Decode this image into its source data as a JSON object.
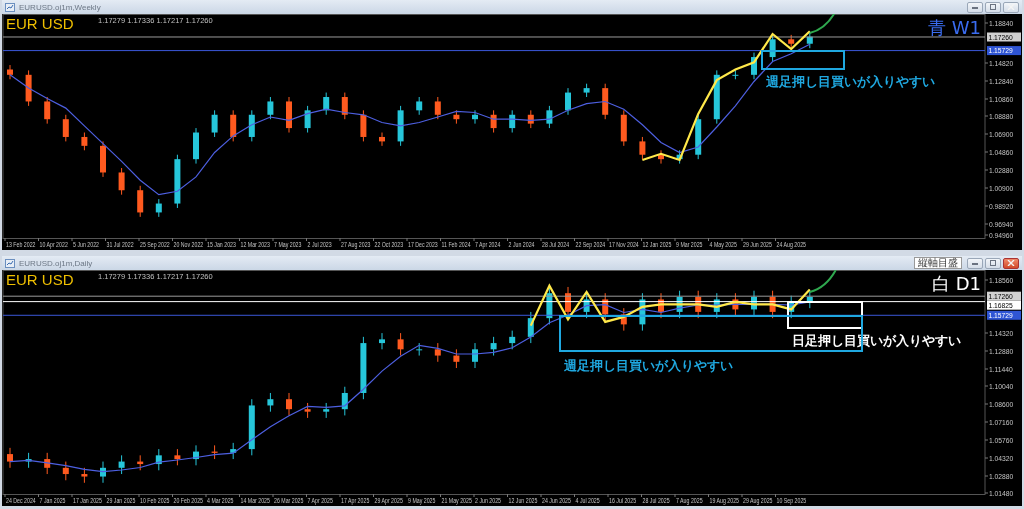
{
  "windows": [
    {
      "title": "EURUSD.oj1m,Weekly",
      "symbol_label": "EUR USD",
      "ohlc": "1.17279 1.17336 1.17217 1.17260",
      "timeframe_label": {
        "text": "青 W1",
        "color": "#3a6cf0"
      },
      "price_tags": [
        {
          "text": "1.17260",
          "kind": "last"
        },
        {
          "text": "1.15729",
          "kind": "line"
        }
      ],
      "notes": [
        {
          "text": "週足押し目買いが入りやすい",
          "color": "#1fa8e0"
        }
      ],
      "x_axis_labels": [
        "13 Feb 2022",
        "10 Apr 2022",
        "5 Jun 2022",
        "31 Jul 2022",
        "25 Sep 2022",
        "20 Nov 2022",
        "15 Jan 2023",
        "12 Mar 2023",
        "7 May 2023",
        "2 Jul 2023",
        "27 Aug 2023",
        "22 Oct 2023",
        "17 Dec 2023",
        "11 Feb 2024",
        "7 Apr 2024",
        "2 Jun 2024",
        "28 Jul 2024",
        "22 Sep 2024",
        "17 Nov 2024",
        "12 Jan 2025",
        "9 Mar 2025",
        "4 May 2025",
        "29 Jun 2025",
        "24 Aug 2025"
      ],
      "y_axis_labels": [
        "1.18840",
        "1.14820",
        "1.12840",
        "1.10860",
        "1.08880",
        "1.06900",
        "1.04860",
        "1.02880",
        "1.00900",
        "0.98920",
        "0.96940",
        "0.94960"
      ]
    },
    {
      "title": "EURUSD.oj1m,Daily",
      "symbol_label": "EUR USD",
      "ohlc": "1.17279 1.17336 1.17217 1.17260",
      "timeframe_label": {
        "text": "白 D1",
        "color": "#ffffff"
      },
      "tooltip": "縦軸目盛",
      "price_tags": [
        {
          "text": "1.17260",
          "kind": "last"
        },
        {
          "text": "1.16825",
          "kind": "level"
        },
        {
          "text": "1.15729",
          "kind": "line"
        }
      ],
      "notes": [
        {
          "text": "日足押し目買いが入りやすい",
          "color": "#ffffff"
        },
        {
          "text": "週足押し目買いが入りやすい",
          "color": "#1fa8e0"
        }
      ],
      "x_axis_labels": [
        "24 Dec 2024",
        "7 Jan 2025",
        "17 Jan 2025",
        "29 Jan 2025",
        "10 Feb 2025",
        "20 Feb 2025",
        "4 Mar 2025",
        "14 Mar 2025",
        "26 Mar 2025",
        "7 Apr 2025",
        "17 Apr 2025",
        "29 Apr 2025",
        "9 May 2025",
        "21 May 2025",
        "2 Jun 2025",
        "12 Jun 2025",
        "24 Jun 2025",
        "4 Jul 2025",
        "16 Jul 2025",
        "28 Jul 2025",
        "7 Aug 2025",
        "19 Aug 2025",
        "29 Aug 2025",
        "10 Sep 2025"
      ],
      "y_axis_labels": [
        "1.18560",
        "1.14320",
        "1.12880",
        "1.11440",
        "1.10040",
        "1.08600",
        "1.07160",
        "1.05760",
        "1.04320",
        "1.02880",
        "1.01480"
      ]
    }
  ]
}
